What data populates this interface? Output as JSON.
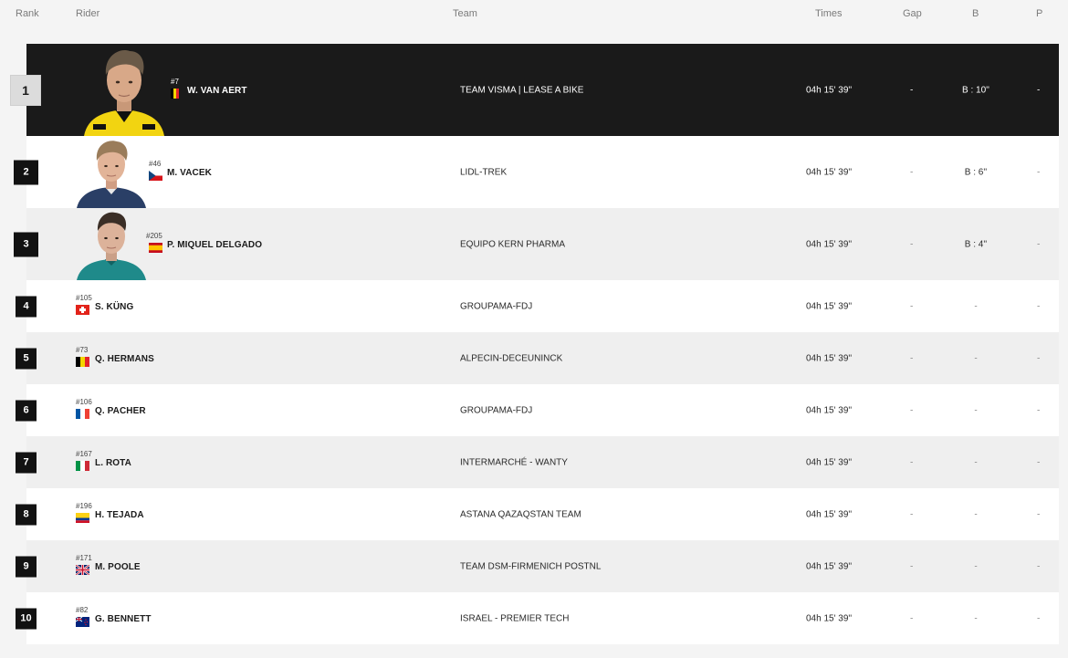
{
  "columns": {
    "rank": "Rank",
    "rider": "Rider",
    "team": "Team",
    "times": "Times",
    "gap": "Gap",
    "b": "B",
    "p": "P"
  },
  "rows": [
    {
      "rank": "1",
      "bib": "#7",
      "name": "W. VAN AERT",
      "flag_icon": "belgium-flag-icon",
      "team": "TEAM VISMA | LEASE A BIKE",
      "time": "04h 15' 39''",
      "gap": "-",
      "b": "B : 10''",
      "p": "-"
    },
    {
      "rank": "2",
      "bib": "#46",
      "name": "M. VACEK",
      "flag_icon": "czech-flag-icon",
      "team": "LIDL-TREK",
      "time": "04h 15' 39''",
      "gap": "-",
      "b": "B : 6''",
      "p": "-"
    },
    {
      "rank": "3",
      "bib": "#205",
      "name": "P. MIQUEL DELGADO",
      "flag_icon": "spain-flag-icon",
      "team": "EQUIPO KERN PHARMA",
      "time": "04h 15' 39''",
      "gap": "-",
      "b": "B : 4''",
      "p": "-"
    },
    {
      "rank": "4",
      "bib": "#105",
      "name": "S. KÜNG",
      "flag_icon": "switzerland-flag-icon",
      "team": "GROUPAMA-FDJ",
      "time": "04h 15' 39''",
      "gap": "-",
      "b": "-",
      "p": "-"
    },
    {
      "rank": "5",
      "bib": "#73",
      "name": "Q. HERMANS",
      "flag_icon": "belgium-flag-icon",
      "team": "ALPECIN-DECEUNINCK",
      "time": "04h 15' 39''",
      "gap": "-",
      "b": "-",
      "p": "-"
    },
    {
      "rank": "6",
      "bib": "#106",
      "name": "Q. PACHER",
      "flag_icon": "france-flag-icon",
      "team": "GROUPAMA-FDJ",
      "time": "04h 15' 39''",
      "gap": "-",
      "b": "-",
      "p": "-"
    },
    {
      "rank": "7",
      "bib": "#167",
      "name": "L. ROTA",
      "flag_icon": "italy-flag-icon",
      "team": "INTERMARCHÉ - WANTY",
      "time": "04h 15' 39''",
      "gap": "-",
      "b": "-",
      "p": "-"
    },
    {
      "rank": "8",
      "bib": "#196",
      "name": "H. TEJADA",
      "flag_icon": "colombia-flag-icon",
      "team": "ASTANA QAZAQSTAN TEAM",
      "time": "04h 15' 39''",
      "gap": "-",
      "b": "-",
      "p": "-"
    },
    {
      "rank": "9",
      "bib": "#171",
      "name": "M. POOLE",
      "flag_icon": "uk-flag-icon",
      "team": "TEAM DSM-FIRMENICH POSTNL",
      "time": "04h 15' 39''",
      "gap": "-",
      "b": "-",
      "p": "-"
    },
    {
      "rank": "10",
      "bib": "#82",
      "name": "G. BENNETT",
      "flag_icon": "new-zealand-flag-icon",
      "team": "ISRAEL - PREMIER TECH",
      "time": "04h 15' 39''",
      "gap": "-",
      "b": "-",
      "p": "-"
    }
  ],
  "colors": {
    "leader_row": "#1a1a1a",
    "rank_badge": "#121212",
    "jersey_yellow": "#f2d411"
  }
}
